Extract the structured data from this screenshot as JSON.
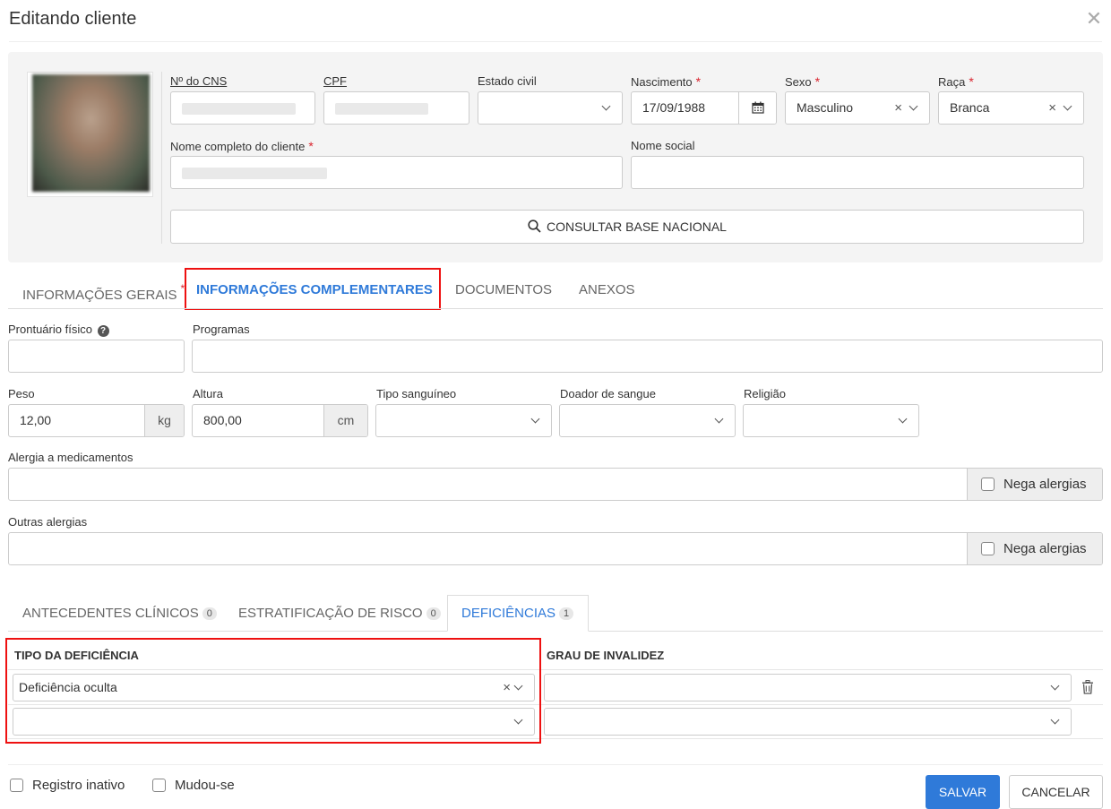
{
  "dialog": {
    "title": "Editando cliente"
  },
  "header_form": {
    "cns_label": "Nº do CNS",
    "cpf_label": "CPF",
    "estado_civil_label": "Estado civil",
    "nascimento_label": "Nascimento",
    "nascimento_value": "17/09/1988",
    "sexo_label": "Sexo",
    "sexo_value": "Masculino",
    "raca_label": "Raça",
    "raca_value": "Branca",
    "nome_label": "Nome completo do cliente",
    "nome_social_label": "Nome social",
    "consultar_label": "CONSULTAR BASE NACIONAL",
    "required_mark": "*"
  },
  "tabs": [
    {
      "label": "INFORMAÇÕES GERAIS"
    },
    {
      "label": "INFORMAÇÕES COMPLEMENTARES"
    },
    {
      "label": "DOCUMENTOS"
    },
    {
      "label": "ANEXOS"
    }
  ],
  "complementares": {
    "prontuario_label": "Prontuário físico",
    "programas_label": "Programas",
    "peso_label": "Peso",
    "peso_value": "12,00",
    "peso_unit": "kg",
    "altura_label": "Altura",
    "altura_value": "800,00",
    "altura_unit": "cm",
    "tipo_sanguineo_label": "Tipo sanguíneo",
    "doador_label": "Doador de sangue",
    "religiao_label": "Religião",
    "alergia_med_label": "Alergia a medicamentos",
    "nega_alergias_label": "Nega alergias",
    "outras_alergias_label": "Outras alergias"
  },
  "subtabs": [
    {
      "label": "ANTECEDENTES CLÍNICOS",
      "count": "0"
    },
    {
      "label": "ESTRATIFICAÇÃO DE RISCO",
      "count": "0"
    },
    {
      "label": "DEFICIÊNCIAS",
      "count": "1"
    }
  ],
  "deficiencias": {
    "col_tipo": "TIPO DA DEFICIÊNCIA",
    "col_grau": "GRAU DE INVALIDEZ",
    "rows": [
      {
        "tipo": "Deficiência oculta",
        "grau": ""
      },
      {
        "tipo": "",
        "grau": ""
      }
    ]
  },
  "footer": {
    "registro_inativo_label": "Registro inativo",
    "mudou_se_label": "Mudou-se",
    "salvar_label": "SALVAR",
    "cancelar_label": "CANCELAR"
  },
  "icons": {
    "close": "close-icon",
    "calendar": "calendar-icon",
    "search": "search-icon",
    "help": "help-icon",
    "trash": "trash-icon",
    "chevron": "chevron-down-icon"
  },
  "colors": {
    "accent": "#2f7ad9",
    "required": "#d9232d",
    "highlight": "#e11111"
  }
}
